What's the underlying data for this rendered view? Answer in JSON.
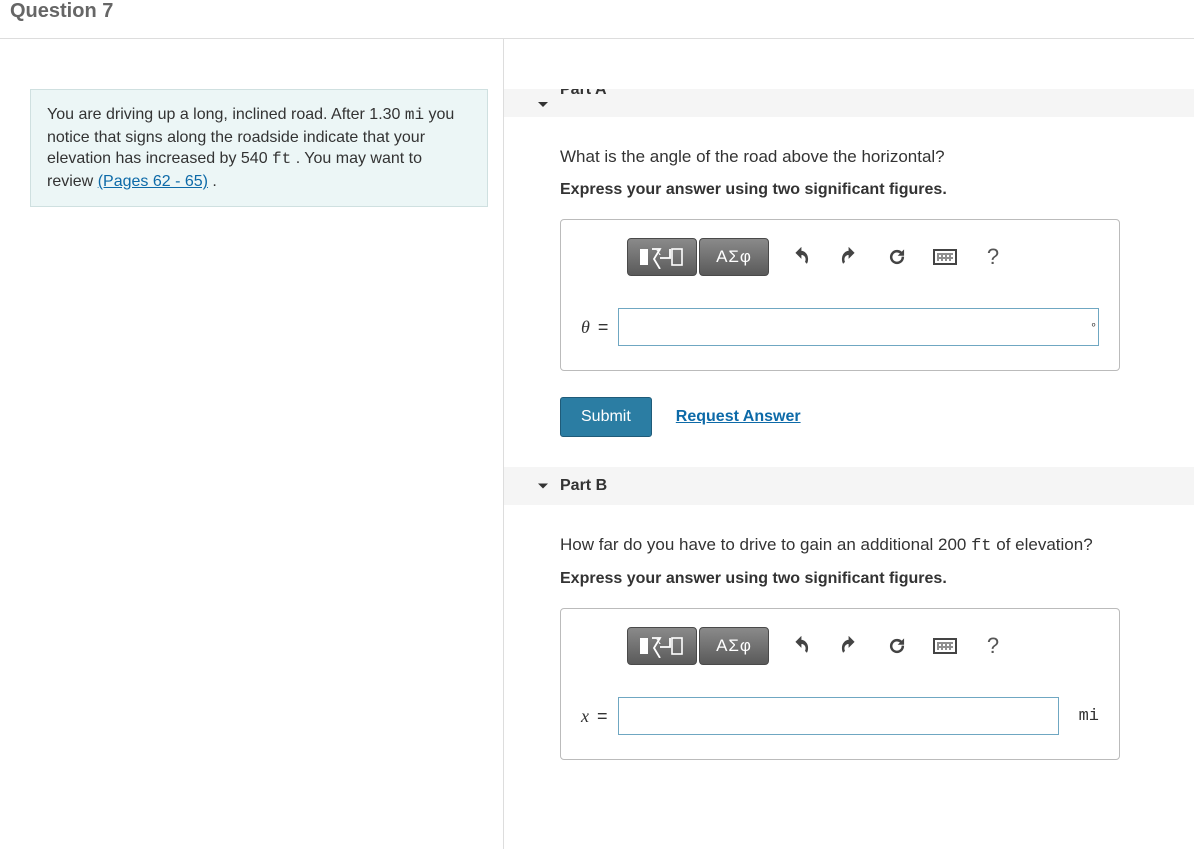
{
  "header": {
    "title": "Question 7"
  },
  "problem": {
    "text_1": "You are driving up a long, inclined road. After 1.30 ",
    "unit_1": "mi",
    "text_2": " you notice that signs along the roadside indicate that your elevation has increased by 540 ",
    "unit_2": "ft",
    "text_3": " . You may want to review ",
    "review_link": "(Pages 62 - 65)",
    "text_4": " ."
  },
  "labels": {
    "submit": "Submit",
    "request": "Request Answer",
    "greek_btn": "ΑΣφ",
    "help": "?"
  },
  "partA": {
    "header": "Part A",
    "question": "What is the angle of the road above the horizontal?",
    "instruction": "Express your answer using two significant figures.",
    "variable": "θ",
    "equals": "=",
    "unit": "∘"
  },
  "partB": {
    "header": "Part B",
    "question_1": "How far do you have to drive to gain an additional 200 ",
    "question_unit": "ft",
    "question_2": " of elevation?",
    "instruction": "Express your answer using two significant figures.",
    "variable": "x",
    "equals": "=",
    "unit": "mi"
  }
}
